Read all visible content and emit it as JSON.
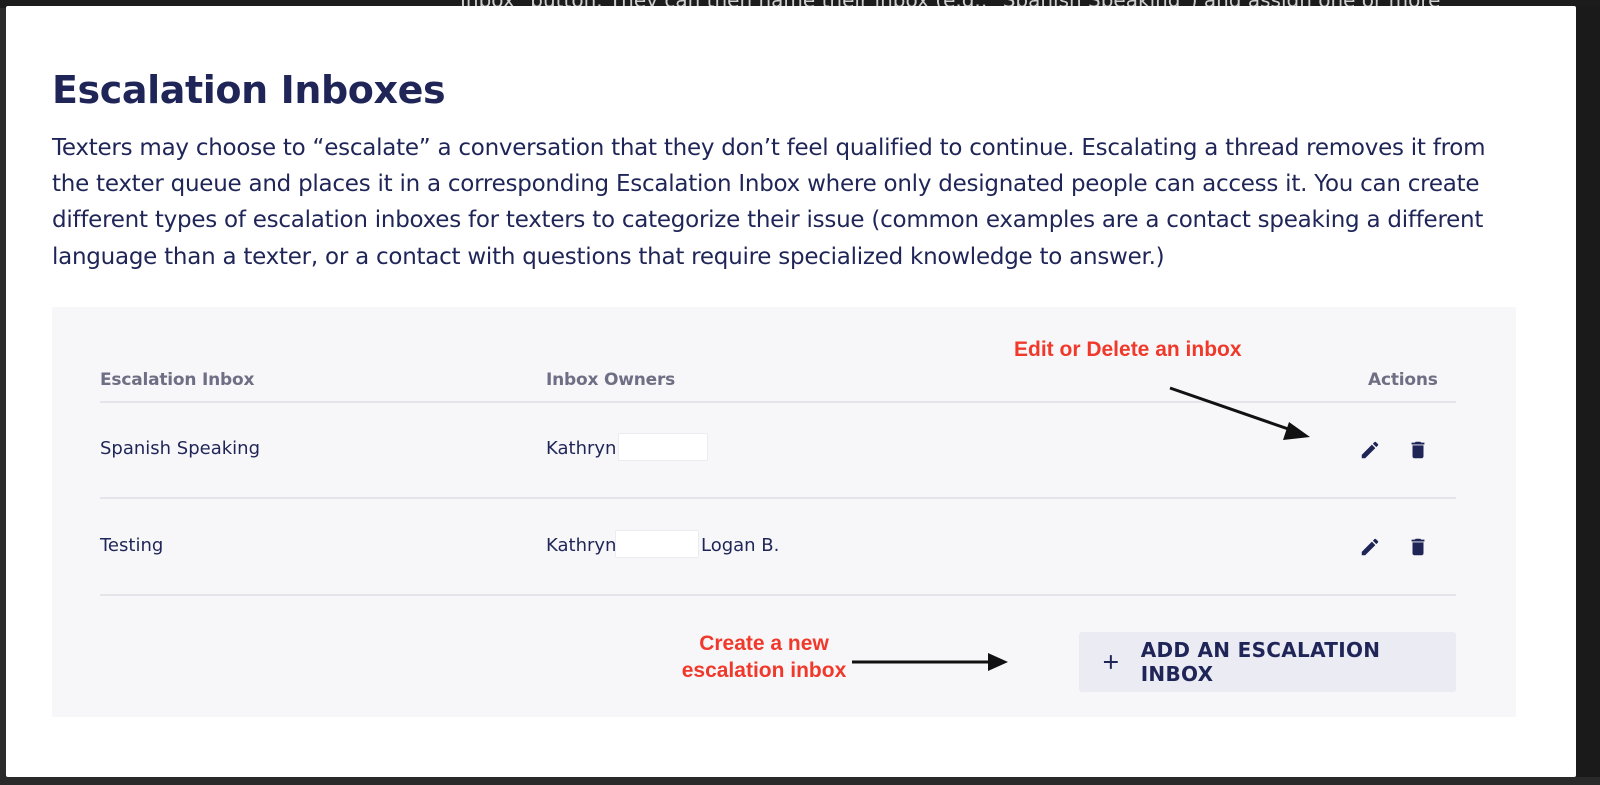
{
  "background_text": "Inbox\" button. They can then name their inbox (e.g., \"Spanish Speaking\") and assign one or more",
  "page": {
    "title": "Escalation Inboxes",
    "description": "Texters may choose to “escalate” a conversation that they don’t feel qualified to continue. Escalating a thread removes it from the texter queue and places it in a corresponding Escalation Inbox where only designated people can access it. You can create different types of escalation inboxes for texters to categorize their issue (common examples are a contact speaking a different language than a texter, or a contact with questions that require specialized knowledge to answer.)"
  },
  "table": {
    "headers": {
      "inbox": "Escalation Inbox",
      "owners": "Inbox Owners",
      "actions": "Actions"
    },
    "rows": [
      {
        "name": "Spanish Speaking",
        "owners": [
          "Kathryn"
        ]
      },
      {
        "name": "Testing",
        "owners": [
          "Kathryn",
          "Logan B."
        ]
      }
    ]
  },
  "add_button": {
    "label": "ADD AN ESCALATION INBOX",
    "icon": "plus-icon"
  },
  "annotations": {
    "edit_delete": "Edit or Delete an inbox",
    "create_line1": "Create a new",
    "create_line2": "escalation inbox"
  },
  "icons": {
    "edit": "pencil-icon",
    "delete": "trash-icon"
  },
  "colors": {
    "text_primary": "#1f2557",
    "header_text": "#6e6f84",
    "annotation_red": "#f0392b",
    "panel_bg": "#f7f7f9",
    "button_bg": "#ebebf4"
  }
}
